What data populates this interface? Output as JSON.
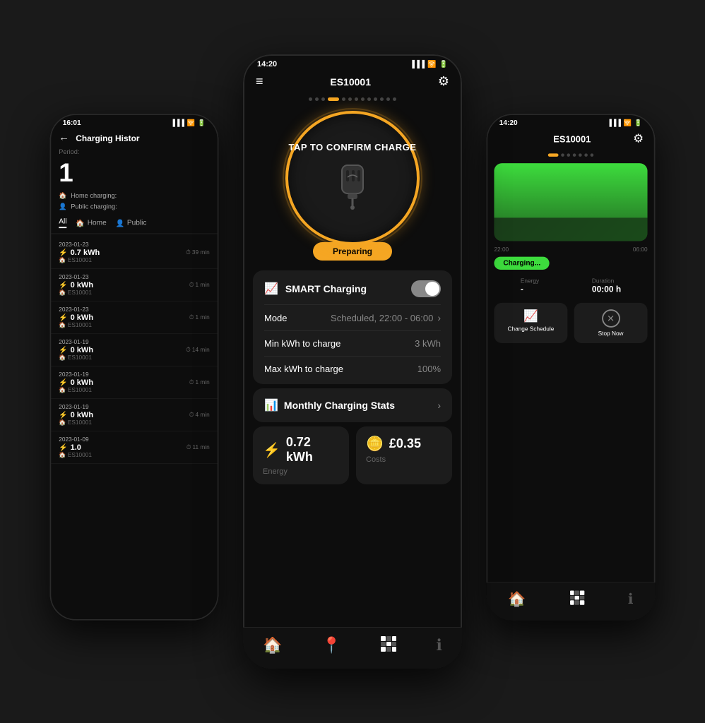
{
  "left_phone": {
    "status_time": "16:01",
    "back_icon": "←",
    "title": "Charging Histor",
    "period_label": "Period:",
    "big_number": "1",
    "home_charging": "Home charging:",
    "public_charging": "Public charging:",
    "filters": [
      "All",
      "Home",
      "Public"
    ],
    "history_items": [
      {
        "date": "2023-01-23",
        "duration": "39 min",
        "kwh": "0.7 kWh",
        "location": "ES10001"
      },
      {
        "date": "2023-01-23",
        "duration": "1 min",
        "kwh": "0 kWh",
        "location": "ES10001"
      },
      {
        "date": "2023-01-23",
        "duration": "1 min",
        "kwh": "0 kWh",
        "location": "ES10001"
      },
      {
        "date": "2023-01-19",
        "duration": "14 min",
        "kwh": "0 kWh",
        "location": "ES10001"
      },
      {
        "date": "2023-01-19",
        "duration": "1 min",
        "kwh": "0 kWh",
        "location": "ES10001"
      },
      {
        "date": "2023-01-19",
        "duration": "4 min",
        "kwh": "0 kWh",
        "location": "ES10001"
      },
      {
        "date": "2023-01-09",
        "duration": "11 min",
        "kwh": "1.0",
        "location": "ES10001"
      }
    ]
  },
  "center_phone": {
    "status_time": "14:20",
    "title": "ES10001",
    "tap_text": "TAP TO CONFIRM CHARGE",
    "preparing_label": "Preparing",
    "smart_charging_label": "SMART Charging",
    "mode_label": "Mode",
    "mode_value": "Scheduled, 22:00 - 06:00",
    "min_kwh_label": "Min kWh to charge",
    "min_kwh_value": "3 kWh",
    "max_kwh_label": "Max kWh to charge",
    "max_kwh_value": "100%",
    "monthly_stats_label": "Monthly Charging Stats",
    "energy_value": "0.72 kWh",
    "energy_label": "Energy",
    "costs_value": "£0.35",
    "costs_label": "Costs",
    "nav_items": [
      "home",
      "location",
      "qr",
      "info"
    ]
  },
  "right_phone": {
    "status_time": "14:20",
    "title": "ES10001",
    "time_start": "22:00",
    "time_end": "06:00",
    "charging_status": "Charging...",
    "energy_label": "Energy",
    "energy_value": "-",
    "duration_label": "Duration",
    "duration_value": "00:00 h",
    "change_schedule_label": "Change Schedule",
    "stop_now_label": "Stop Now"
  },
  "colors": {
    "accent_orange": "#f5a623",
    "accent_green": "#3ddc3d",
    "accent_blue": "#4a9eff",
    "card_bg": "#1c1c1c",
    "phone_bg": "#0d0d0d"
  },
  "dots": [
    1,
    2,
    3,
    4,
    5,
    6,
    7,
    8,
    9,
    10,
    11,
    12,
    13
  ]
}
